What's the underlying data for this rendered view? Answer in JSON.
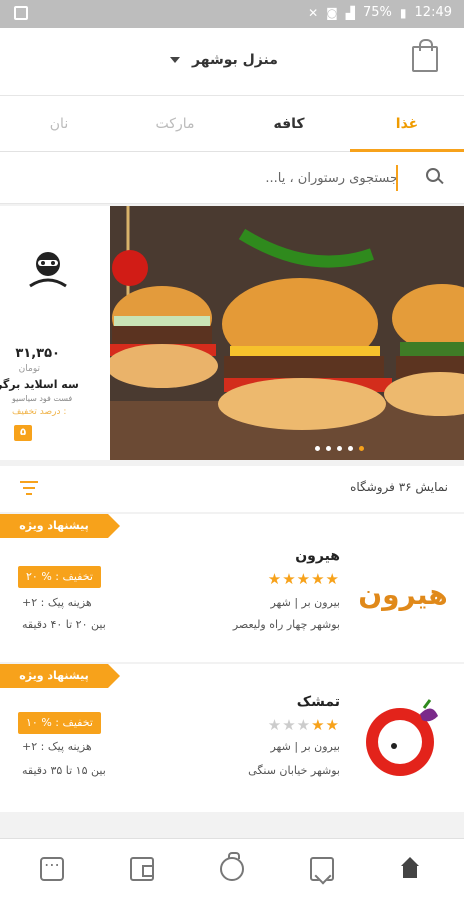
{
  "status_bar": {
    "battery": "75%",
    "time": "12:49",
    "icons": [
      "picture-icon",
      "mute-icon",
      "data-saver-icon",
      "lte-icon",
      "signal-icon",
      "battery-icon"
    ]
  },
  "header": {
    "location": "منزل بوشهر",
    "icons": [
      "bag-icon",
      "caret-down-icon"
    ]
  },
  "tabs": [
    {
      "label": "غذا",
      "active": true
    },
    {
      "label": "کافه",
      "active": false
    },
    {
      "label": "مارکت",
      "active": false
    },
    {
      "label": "نان",
      "active": false
    }
  ],
  "search": {
    "placeholder": "جستجوی رستوران ، یا..."
  },
  "banner": {
    "promo": {
      "price": "۳۱,۳۵۰",
      "currency": "تومان",
      "name": "سه اسلاید برگر",
      "subtitle": "فست فود سیاسیو",
      "discount_label": "درصد تخفیف :",
      "discount_value": "۵"
    },
    "slides_total": 5,
    "slide_active": 1
  },
  "list": {
    "count_text": "نمایش ۳۶ فروشگاه",
    "filter_icon": "filter-icon"
  },
  "restaurants": [
    {
      "special": "پیشنهاد ویژه",
      "name": "هیرون",
      "rating": 5,
      "category": "بیرون بر | شهر",
      "address": "بوشهر چهار راه ولیعصر",
      "discount": "تخفیف : % ۲۰",
      "delivery": "هزینه پیک : ۲+",
      "time": "بین ۲۰ تا ۴۰ دقیقه",
      "logo_text": "هیرون"
    },
    {
      "special": "پیشنهاد ویژه",
      "name": "تمشک",
      "rating": 2,
      "category": "بیرون بر | شهر",
      "address": "بوشهر خیابان سنگی",
      "discount": "تخفیف : % ۱۰",
      "delivery": "هزینه پیک : ۲+",
      "time": "بین ۱۵ تا ۳۵ دقیقه",
      "logo_text": ""
    }
  ],
  "colors": {
    "accent": "#f7a21b",
    "tab_active": "#ef9b00"
  },
  "bottom_nav": [
    "more-icon",
    "wallet-icon",
    "orders-icon",
    "bookmark-icon",
    "home-icon"
  ]
}
